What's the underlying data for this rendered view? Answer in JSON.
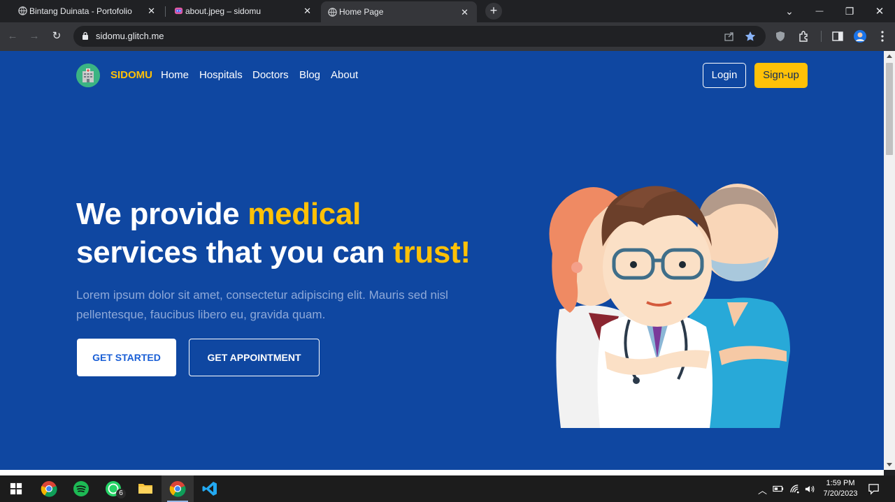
{
  "browser": {
    "tabs": [
      {
        "title": "Bintang Duinata - Portofolio",
        "close": "✕"
      },
      {
        "title": "about.jpeg – sidomu",
        "close": "✕"
      },
      {
        "title": "Home Page",
        "close": "✕"
      }
    ],
    "new_tab": "+",
    "url": "sidomu.glitch.me",
    "window_controls": {
      "tab_search": "⌄",
      "minimize": "—",
      "restore": "❐",
      "close": "✕"
    },
    "nav": {
      "back": "←",
      "forward": "→",
      "reload": "↻"
    }
  },
  "page": {
    "brand": "SIDOMU",
    "nav_links": [
      "Home",
      "Hospitals",
      "Doctors",
      "Blog",
      "About"
    ],
    "login": "Login",
    "signup": "Sign-up",
    "hero": {
      "line1_plain": "We provide ",
      "line1_highlight": "medical",
      "line2_plain": "services that you can ",
      "line2_highlight": "trust!",
      "subtitle": "Lorem ipsum dolor sit amet, consectetur adipiscing elit. Mauris sed nisl pellentesque, faucibus libero eu, gravida quam.",
      "primary_button": "GET STARTED",
      "secondary_button": "GET APPOINTMENT"
    },
    "colors": {
      "background": "#0f47a1",
      "accent": "#ffc107"
    }
  },
  "taskbar": {
    "apps": [
      "windows-start",
      "chrome",
      "spotify",
      "whatsapp",
      "file-explorer",
      "chrome-active",
      "vscode"
    ],
    "whatsapp_badge": "6",
    "time": "1:59 PM",
    "date": "7/20/2023"
  }
}
